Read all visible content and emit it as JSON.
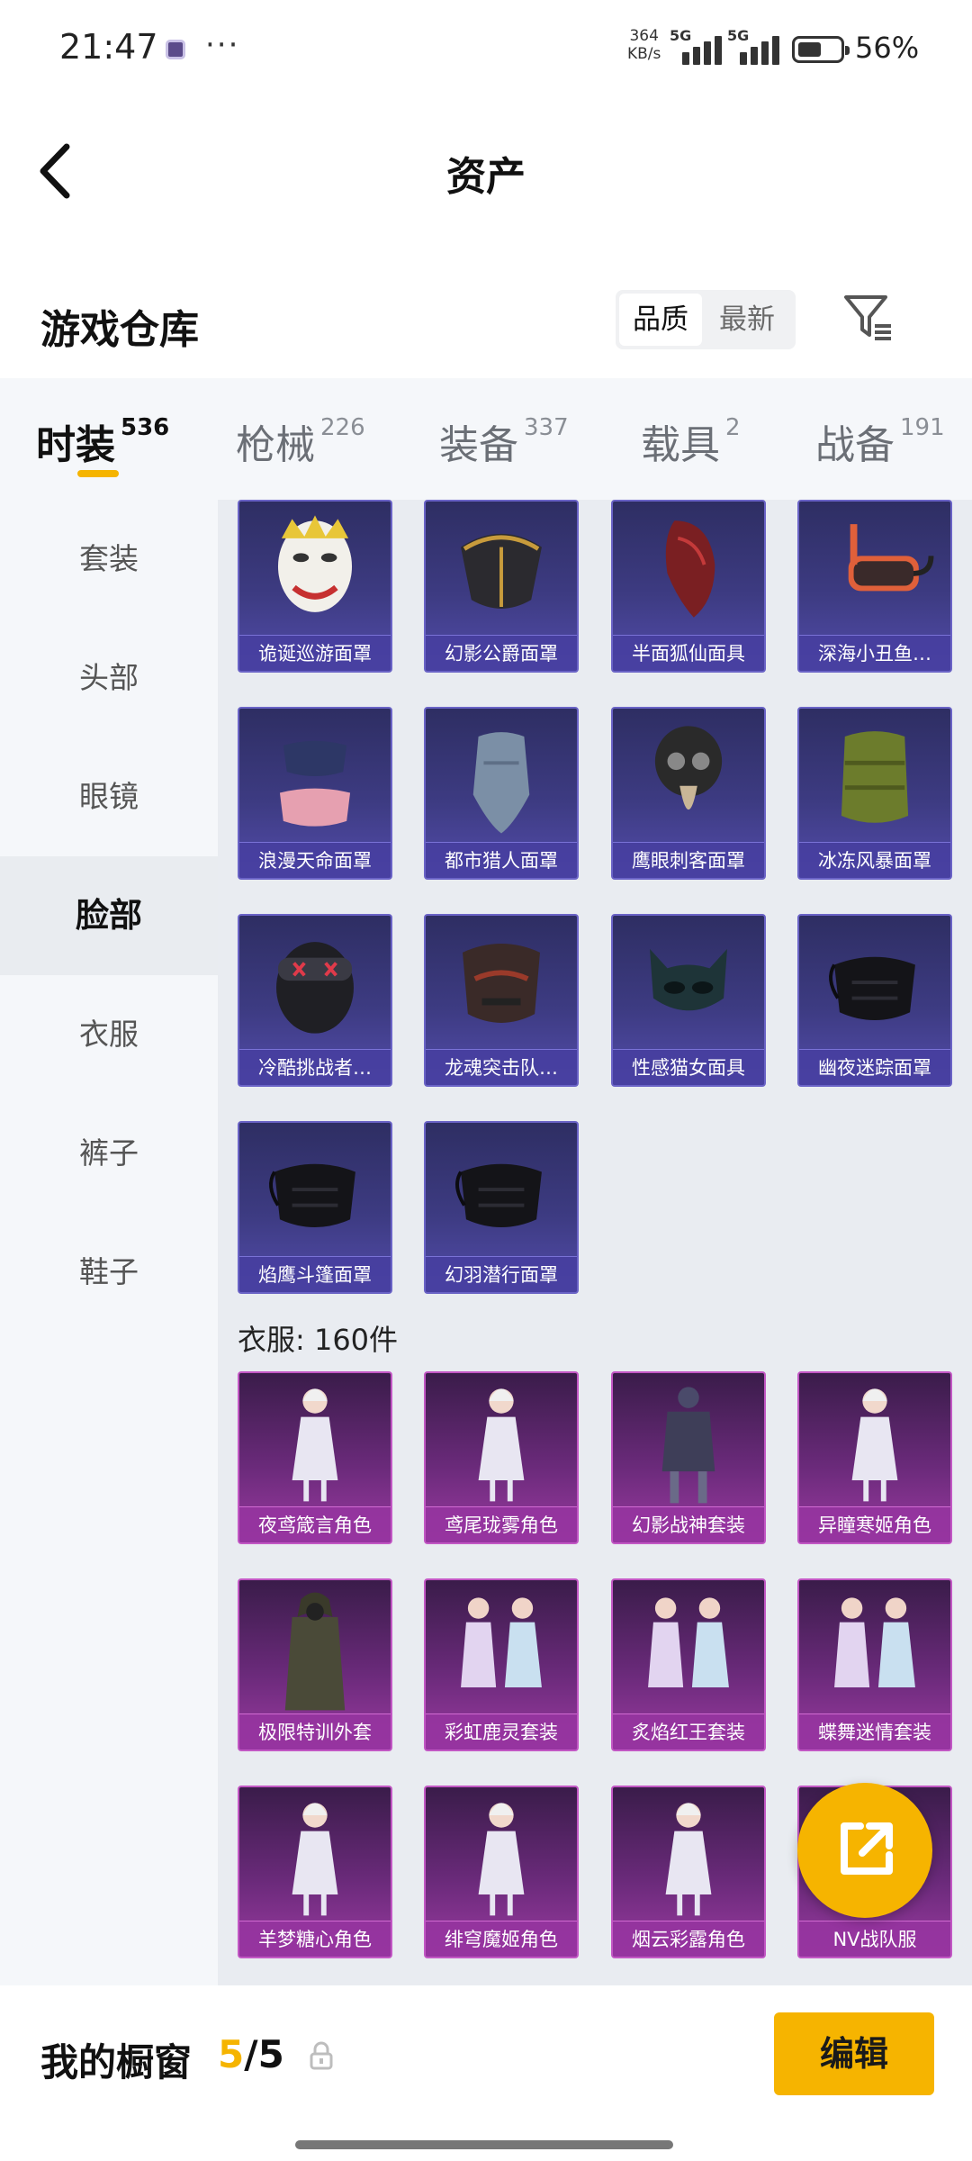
{
  "status": {
    "time": "21:47",
    "net_speed_top": "364",
    "net_speed_bottom": "KB/s",
    "sim1": "5G",
    "sim2": "5G",
    "battery": "56%",
    "battery_level": 0.56
  },
  "header": {
    "title": "资产"
  },
  "section": {
    "title": "游戏仓库",
    "sort_quality": "品质",
    "sort_newest": "最新"
  },
  "tabs": [
    {
      "label": "时装",
      "count": "536"
    },
    {
      "label": "枪械",
      "count": "226"
    },
    {
      "label": "装备",
      "count": "337"
    },
    {
      "label": "载具",
      "count": "2"
    },
    {
      "label": "战备",
      "count": "191"
    }
  ],
  "sidebar": [
    "套装",
    "头部",
    "眼镜",
    "脸部",
    "衣服",
    "裤子",
    "鞋子"
  ],
  "face_items": [
    {
      "name": "诡诞巡游面罩",
      "icon": "clown-mask-icon"
    },
    {
      "name": "幻影公爵面罩",
      "icon": "gold-mask-icon"
    },
    {
      "name": "半面狐仙面具",
      "icon": "fox-mask-icon"
    },
    {
      "name": "深海小丑鱼…",
      "icon": "snorkel-mask-icon"
    },
    {
      "name": "浪漫天命面罩",
      "icon": "face-mask-icon"
    },
    {
      "name": "都市猎人面罩",
      "icon": "bandana-icon"
    },
    {
      "name": "鹰眼刺客面罩",
      "icon": "plague-mask-icon"
    },
    {
      "name": "冰冻风暴面罩",
      "icon": "scarf-icon"
    },
    {
      "name": "冷酷挑战者…",
      "icon": "goggle-mask-icon"
    },
    {
      "name": "龙魂突击队…",
      "icon": "tactical-mask-icon"
    },
    {
      "name": "性感猫女面具",
      "icon": "cat-mask-icon"
    },
    {
      "name": "幽夜迷踪面罩",
      "icon": "black-mask-icon"
    },
    {
      "name": "焰鹰斗篷面罩",
      "icon": "black-mask-icon"
    },
    {
      "name": "幻羽潜行面罩",
      "icon": "black-mask-icon"
    }
  ],
  "clothes_group": {
    "label": "衣服: 160件"
  },
  "clothes_items": [
    {
      "name": "夜鸢箴言角色",
      "icon": "character-icon"
    },
    {
      "name": "鸢尾珑雾角色",
      "icon": "character-icon"
    },
    {
      "name": "幻影战神套装",
      "icon": "armor-icon"
    },
    {
      "name": "异瞳寒姬角色",
      "icon": "character-icon"
    },
    {
      "name": "极限特训外套",
      "icon": "coat-icon"
    },
    {
      "name": "彩虹鹿灵套装",
      "icon": "outfit-icon"
    },
    {
      "name": "炙焰红王套装",
      "icon": "outfit-icon"
    },
    {
      "name": "蝶舞迷情套装",
      "icon": "outfit-icon"
    },
    {
      "name": "羊梦糖心角色",
      "icon": "character-icon"
    },
    {
      "name": "绯穹魔姬角色",
      "icon": "character-icon"
    },
    {
      "name": "烟云彩露角色",
      "icon": "character-icon"
    },
    {
      "name": "NV战队服",
      "icon": "outfit-icon"
    }
  ],
  "bottom": {
    "title": "我的橱窗",
    "current": "5",
    "separator": "/",
    "total": "5",
    "edit": "编辑"
  },
  "colors": {
    "accent": "#f6b400",
    "face_card": "#3d3b82",
    "clothes_card": "#6a2a7a"
  }
}
